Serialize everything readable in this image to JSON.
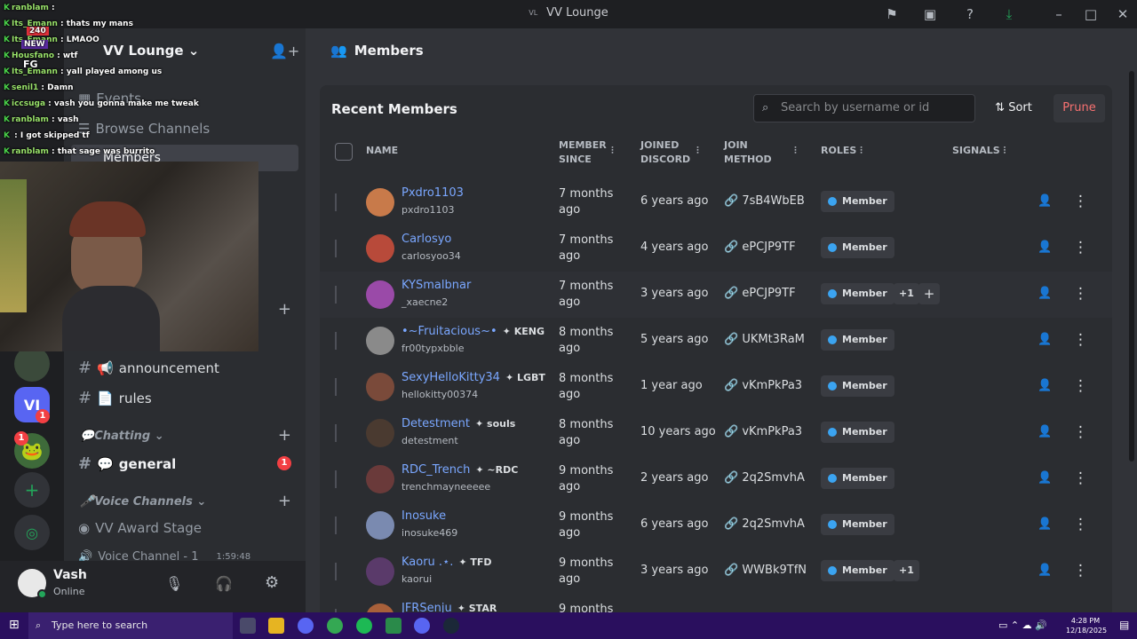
{
  "window": {
    "title": "VV Lounge",
    "prefix": "VL"
  },
  "server": {
    "name": "VV Lounge"
  },
  "channels": {
    "events": "Events",
    "browse": "Browse Channels",
    "members": "Members",
    "announcement": "announcement",
    "rules": "rules",
    "category_chatting": "Chatting",
    "general": "general",
    "general_badge": "1",
    "category_voice": "Voice Channels",
    "award_stage": "VV Award Stage",
    "voice_channel": "Voice Channel - 1",
    "voice_time": "1:59:48"
  },
  "guild_badges": {
    "vl": "1",
    "pepe": "1"
  },
  "user": {
    "name": "Vash",
    "status": "Online"
  },
  "stream_chat": [
    {
      "user": "ranblam",
      "msg": ""
    },
    {
      "user": "Its_Emann",
      "msg": "thats my mans"
    },
    {
      "user": "Its_Emann",
      "msg": "LMAOO"
    },
    {
      "user": "Housfano",
      "msg": "wtf"
    },
    {
      "user": "Its_Emann",
      "msg": "yall played among us"
    },
    {
      "user": "senil1",
      "msg": "Damn"
    },
    {
      "user": "iccsuga",
      "msg": "vash you gonna make me tweak"
    },
    {
      "user": "ranblam",
      "msg": "vash"
    },
    {
      "user": "",
      "msg": "I got skipped tf"
    },
    {
      "user": "ranblam",
      "msg": "that sage was burrito"
    }
  ],
  "stream_overlay": {
    "viewers": "240",
    "new_label": "NEW",
    "fg": "FG"
  },
  "main": {
    "header": "Members",
    "panel_title": "Recent Members",
    "search_placeholder": "Search by username or id",
    "sort_label": "Sort",
    "prune_label": "Prune",
    "columns": {
      "name": "NAME",
      "member_since_1": "MEMBER",
      "member_since_2": "SINCE",
      "joined_1": "JOINED",
      "joined_2": "DISCORD",
      "method_1": "JOIN",
      "method_2": "METHOD",
      "roles": "ROLES",
      "signals": "SIGNALS"
    }
  },
  "members": [
    {
      "name": "Pxdro1103",
      "handle": "pxdro1103",
      "tag": "",
      "since1": "7 months",
      "since2": "ago",
      "joined": "6 years ago",
      "invite": "7sB4WbEB",
      "role": "Member",
      "extra": "",
      "color": "#c87a4a"
    },
    {
      "name": "Carlosyo",
      "handle": "carlosyoo34",
      "tag": "",
      "since1": "7 months",
      "since2": "ago",
      "joined": "4 years ago",
      "invite": "ePCJP9TF",
      "role": "Member",
      "extra": "",
      "color": "#b84a3a"
    },
    {
      "name": "KYSmalbnar",
      "handle": "_xaecne2",
      "tag": "",
      "since1": "7 months",
      "since2": "ago",
      "joined": "3 years ago",
      "invite": "ePCJP9TF",
      "role": "Member",
      "extra": "+1",
      "color": "#9a4aa8"
    },
    {
      "name": "•~Fruitacious~•",
      "handle": "fr00typxbble",
      "tag": "KENG",
      "since1": "8 months",
      "since2": "ago",
      "joined": "5 years ago",
      "invite": "UKMt3RaM",
      "role": "Member",
      "extra": "",
      "color": "#8a8a8a"
    },
    {
      "name": "SexyHelloKitty34",
      "handle": "hellokitty00374",
      "tag": "LGBT",
      "since1": "8 months",
      "since2": "ago",
      "joined": "1 year ago",
      "invite": "vKmPkPa3",
      "role": "Member",
      "extra": "",
      "color": "#7a4a3a"
    },
    {
      "name": "Detestment",
      "handle": "detestment",
      "tag": "souls",
      "since1": "8 months",
      "since2": "ago",
      "joined": "10 years ago",
      "invite": "vKmPkPa3",
      "role": "Member",
      "extra": "",
      "color": "#4a3a30"
    },
    {
      "name": "RDC_Trench",
      "handle": "trenchmayneeeee",
      "tag": "~RDC",
      "since1": "9 months",
      "since2": "ago",
      "joined": "2 years ago",
      "invite": "2q2SmvhA",
      "role": "Member",
      "extra": "",
      "color": "#6a3a3a"
    },
    {
      "name": "Inosuke",
      "handle": "inosuke469",
      "tag": "",
      "since1": "9 months",
      "since2": "ago",
      "joined": "6 years ago",
      "invite": "2q2SmvhA",
      "role": "Member",
      "extra": "",
      "color": "#7a8ab0"
    },
    {
      "name": "Kaoru .⋆.",
      "handle": "kaorui",
      "tag": "TFD",
      "since1": "9 months",
      "since2": "ago",
      "joined": "3 years ago",
      "invite": "WWBk9TfN",
      "role": "Member",
      "extra": "+1",
      "color": "#5a3a6a"
    },
    {
      "name": "JFRSenju",
      "handle": "",
      "tag": "STAR",
      "since1": "9 months",
      "since2": "",
      "joined": "",
      "invite": "",
      "role": "",
      "extra": "",
      "color": "#a8603a"
    }
  ],
  "taskbar": {
    "search": "Type here to search",
    "time": "4:28 PM",
    "date": "12/18/2025"
  },
  "colors": {
    "accent": "#5865f2",
    "link": "#7aa7ff",
    "prune": "#f87171",
    "role_dot": "#3ba4f1",
    "taskbar": "#2a0f5e"
  }
}
